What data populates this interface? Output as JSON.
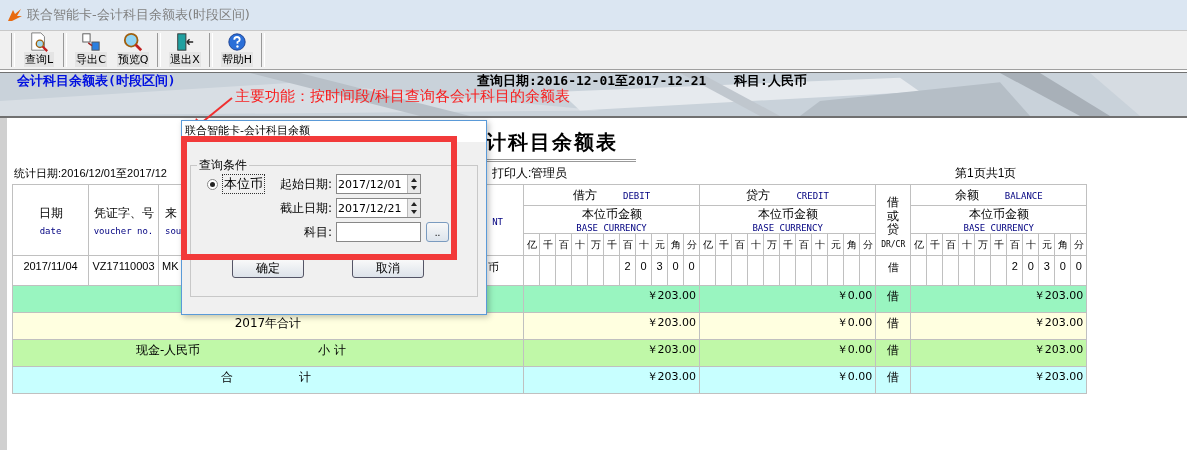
{
  "window": {
    "title": "联合智能卡-会计科目余额表(时段区间)"
  },
  "toolbar": [
    {
      "label": "查询L",
      "kind": "query"
    },
    {
      "label": "导出C",
      "kind": "export"
    },
    {
      "label": "预览Q",
      "kind": "preview"
    },
    {
      "label": "退出X",
      "kind": "exit"
    },
    {
      "label": "帮助H",
      "kind": "help"
    }
  ],
  "banner": {
    "title": "会计科目余额表(时段区间)",
    "query_date": "查询日期:2016-12-01至2017-12-21",
    "subject": "科目:人民币"
  },
  "annotation": "主要功能：按时间段/科目查询各会计科目的余额表",
  "report": {
    "title": "计科目余额表",
    "period": "统计日期:2016/12/01至2017/12",
    "printer": "打印人:管理员",
    "page": "第1页共1页",
    "columns": [
      {
        "zh": "日期",
        "en": "date"
      },
      {
        "zh": "凭证字、号",
        "en": "voucher no."
      },
      {
        "zh": "来",
        "en": "sou"
      },
      {
        "en": "NT"
      }
    ],
    "amount_groups": [
      {
        "zh": "借方",
        "en": "DEBIT",
        "sub_zh": "本位币金额",
        "sub_en": "BASE CURRENCY",
        "digits": [
          "亿",
          "千",
          "百",
          "十",
          "万",
          "千",
          "百",
          "十",
          "元",
          "角",
          "分"
        ]
      },
      {
        "zh": "贷方",
        "en": "CREDIT",
        "sub_zh": "本位币金额",
        "sub_en": "BASE CURRENCY",
        "digits": [
          "亿",
          "千",
          "百",
          "十",
          "万",
          "千",
          "百",
          "十",
          "元",
          "角",
          "分"
        ]
      },
      {
        "zh": "余额",
        "en": "BALANCE",
        "sub_zh": "本位币金额",
        "sub_en": "BASE CURRENCY",
        "digits": [
          "亿",
          "千",
          "百",
          "十",
          "万",
          "千",
          "百",
          "十",
          "元",
          "角",
          "分"
        ]
      }
    ],
    "dc_header": {
      "zh": "借或贷",
      "en": "DR/CR"
    },
    "entries": [
      {
        "date": "2017/11/04",
        "voucher": "VZ17110003",
        "source": "MK",
        "account": "币",
        "debit": [
          "2",
          "0",
          "3",
          "0",
          "0"
        ],
        "dc": "借",
        "balance": [
          "2",
          "0",
          "3",
          "0",
          "0"
        ]
      }
    ],
    "summary_rows": [
      {
        "kind": "group",
        "color": "#99f5c0",
        "debit": "￥203.00",
        "credit": "￥0.00",
        "dc": "借",
        "balance": "￥203.00"
      },
      {
        "kind": "year",
        "color": "#ffffe0",
        "labels": [
          "2017年合计"
        ],
        "debit": "￥203.00",
        "credit": "￥0.00",
        "dc": "借",
        "balance": "￥203.00"
      },
      {
        "kind": "subtotal",
        "color": "#c0f8a8",
        "labels": [
          "现金-人民币",
          "小 计"
        ],
        "debit": "￥203.00",
        "credit": "￥0.00",
        "dc": "借",
        "balance": "￥203.00"
      },
      {
        "kind": "total",
        "color": "#c8ffff",
        "labels": [
          "合",
          "计"
        ],
        "debit": "￥203.00",
        "credit": "￥0.00",
        "dc": "借",
        "balance": "￥203.00"
      }
    ]
  },
  "dialog": {
    "title": "联合智能卡-会计科目余额",
    "group": "查询条件",
    "currency": {
      "label": "本位币",
      "checked": true
    },
    "fields": [
      {
        "label": "起始日期:",
        "value": "2017/12/01",
        "kind": "date"
      },
      {
        "label": "截止日期:",
        "value": "2017/12/21",
        "kind": "date"
      },
      {
        "label": "科目:",
        "kind": "lookup",
        "button": ".."
      }
    ],
    "buttons": [
      "确定",
      "取消"
    ]
  }
}
